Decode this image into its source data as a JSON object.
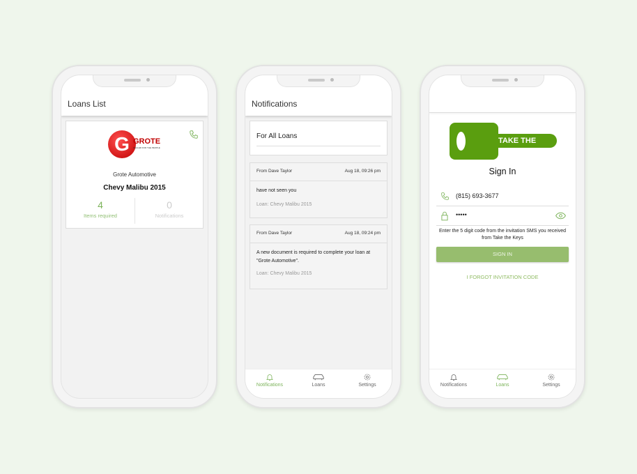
{
  "accent": "#7cb35a",
  "loans": {
    "title": "Loans List",
    "dealer": "Grote Automotive",
    "logo_text": "GROTE",
    "logo_tagline": "DEALER FOR THE PEOPLE",
    "car": "Chevy Malibu 2015",
    "items_count": "4",
    "items_label": "Items required",
    "notif_count": "0",
    "notif_label": "Notifications"
  },
  "notifications": {
    "title": "Notifications",
    "filter": "For All Loans",
    "items": [
      {
        "from": "From Dave Taylor",
        "time": "Aug 18, 09:26 pm",
        "message": "have not seen you",
        "loan": "Loan: Chevy Malibu 2015"
      },
      {
        "from": "From Dave Taylor",
        "time": "Aug 18, 09:24 pm",
        "message": "A new document is required to complete your loan at \"Grote Automotive\".",
        "loan": "Loan: Chevy Malibu 2015"
      }
    ]
  },
  "tabs": {
    "notifications": "Notifications",
    "loans": "Loans",
    "settings": "Settings"
  },
  "signin": {
    "logo_text": "TAKE THE KEYS",
    "title": "Sign In",
    "phone": "(815) 693-3677",
    "code": "•••••",
    "hint": "Enter the 5 digit code from the invitation SMS you received from Take the Keys",
    "button": "SIGN IN",
    "forgot": "I FORGOT INVITATION CODE"
  }
}
